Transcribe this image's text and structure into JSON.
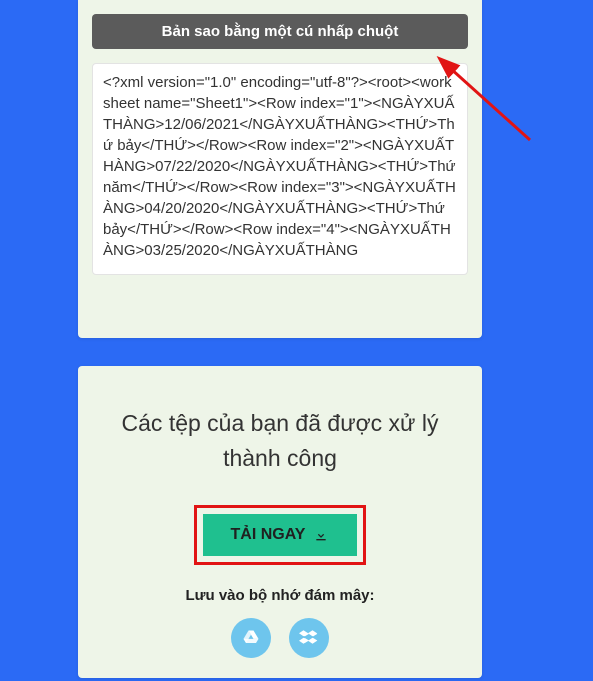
{
  "top": {
    "copy_button_label": "Bản sao bằng một cú nhấp chuột",
    "xml_content": "<?xml version=\"1.0\" encoding=\"utf-8\"?><root><worksheet name=\"Sheet1\"><Row  index=\"1\"><NGÀYXUẤTHÀNG>12/06/2021</NGÀYXUẤTHÀNG><THỨ>Thứ bảy</THỨ></Row><Row  index=\"2\"><NGÀYXUẤTHÀNG>07/22/2020</NGÀYXUẤTHÀNG><THỨ>Thứ năm</THỨ></Row><Row  index=\"3\"><NGÀYXUẤTHÀNG>04/20/2020</NGÀYXUẤTHÀNG><THỨ>Thứ bảy</THỨ></Row><Row  index=\"4\"><NGÀYXUẤTHÀNG>03/25/2020</NGÀYXUẤTHÀNG"
  },
  "bottom": {
    "success_title": "Các tệp của bạn đã được xử lý thành công",
    "download_label": "TẢI NGAY",
    "cloud_label": "Lưu vào bộ nhớ đám mây:"
  },
  "icons": {
    "download": "download-icon",
    "gdrive": "google-drive-icon",
    "dropbox": "dropbox-icon"
  },
  "colors": {
    "bg": "#2b6af5",
    "card": "#eef5e8",
    "copy_btn": "#5b5b5b",
    "download_btn": "#1fc08f",
    "highlight_border": "#e11414",
    "cloud_icon_bg": "#6ec5ed"
  }
}
